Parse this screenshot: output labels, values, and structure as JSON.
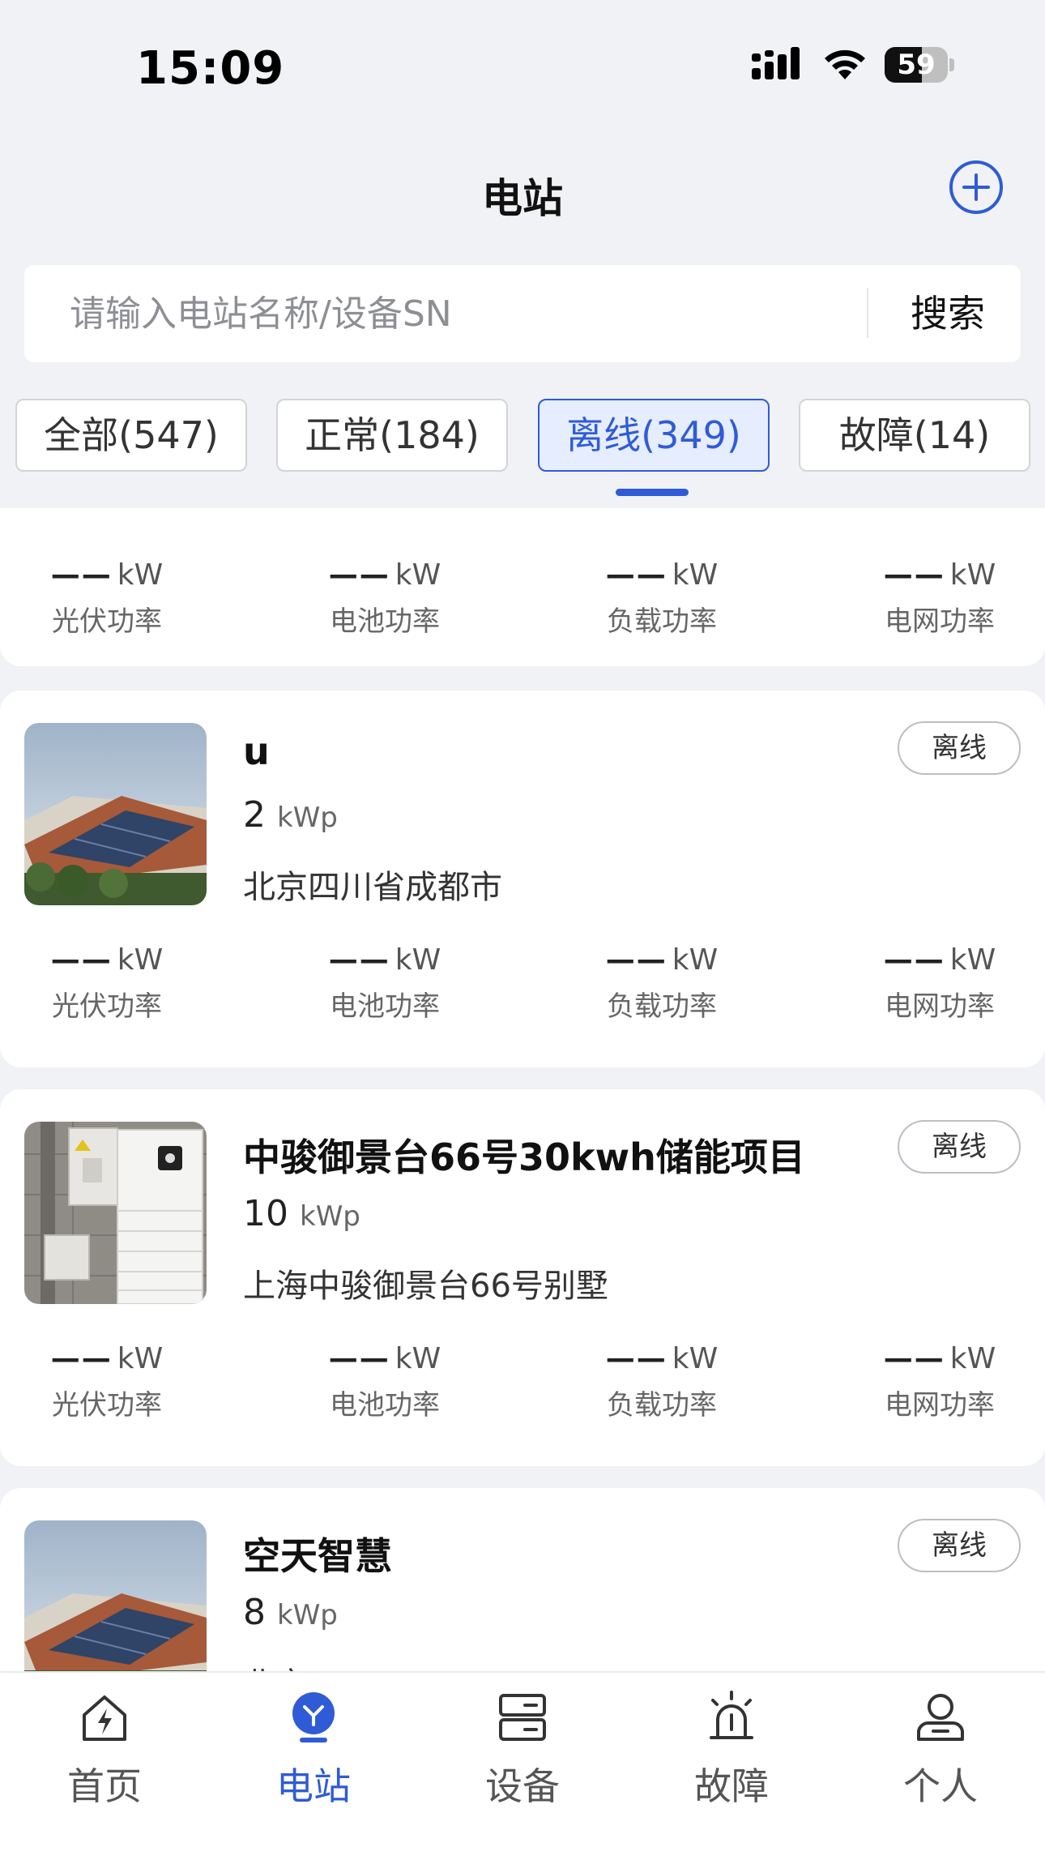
{
  "status_bar": {
    "time": "15:09",
    "battery_level": "59",
    "battery_fraction": 0.59
  },
  "header": {
    "title": "电站",
    "add_icon": "plus-circle-icon"
  },
  "search": {
    "placeholder": "请输入电站名称/设备SN",
    "value": "",
    "button_label": "搜索"
  },
  "filters": [
    {
      "label": "全部(547)",
      "active": false
    },
    {
      "label": "正常(184)",
      "active": false
    },
    {
      "label": "离线(349)",
      "active": true
    },
    {
      "label": "故障(14)",
      "active": false
    }
  ],
  "metric_labels": [
    "光伏功率",
    "电池功率",
    "负载功率",
    "电网功率"
  ],
  "metric_placeholder": "——",
  "metric_unit": "kW",
  "partial_card": {
    "metrics": [
      {
        "value": "——",
        "unit": "kW",
        "label": "光伏功率"
      },
      {
        "value": "——",
        "unit": "kW",
        "label": "电池功率"
      },
      {
        "value": "——",
        "unit": "kW",
        "label": "负载功率"
      },
      {
        "value": "——",
        "unit": "kW",
        "label": "电网功率"
      }
    ]
  },
  "stations": [
    {
      "name": "u",
      "capacity": "2",
      "capacity_unit": "kWp",
      "address": "北京四川省成都市",
      "status": "离线",
      "thumb": "solar-roof-image",
      "metrics": [
        {
          "value": "——",
          "unit": "kW",
          "label": "光伏功率"
        },
        {
          "value": "——",
          "unit": "kW",
          "label": "电池功率"
        },
        {
          "value": "——",
          "unit": "kW",
          "label": "负载功率"
        },
        {
          "value": "——",
          "unit": "kW",
          "label": "电网功率"
        }
      ]
    },
    {
      "name": "中骏御景台66号30kwh储能项目",
      "capacity": "10",
      "capacity_unit": "kWp",
      "address": "上海中骏御景台66号别墅",
      "status": "离线",
      "thumb": "battery-cabinet-image",
      "metrics": [
        {
          "value": "——",
          "unit": "kW",
          "label": "光伏功率"
        },
        {
          "value": "——",
          "unit": "kW",
          "label": "电池功率"
        },
        {
          "value": "——",
          "unit": "kW",
          "label": "负载功率"
        },
        {
          "value": "——",
          "unit": "kW",
          "label": "电网功率"
        }
      ]
    },
    {
      "name": "空天智慧",
      "capacity": "8",
      "capacity_unit": "kWp",
      "address": "北京",
      "status": "离线",
      "thumb": "solar-roof-image"
    }
  ],
  "tabbar": [
    {
      "label": "首页",
      "icon": "home-bolt-icon",
      "active": false
    },
    {
      "label": "电站",
      "icon": "station-pin-icon",
      "active": true
    },
    {
      "label": "设备",
      "icon": "device-icon",
      "active": false
    },
    {
      "label": "故障",
      "icon": "alarm-icon",
      "active": false
    },
    {
      "label": "个人",
      "icon": "person-icon",
      "active": false
    }
  ],
  "colors": {
    "accent": "#2f5bd6",
    "background": "#f1f2f5",
    "card": "#ffffff",
    "text_secondary": "#666666"
  }
}
